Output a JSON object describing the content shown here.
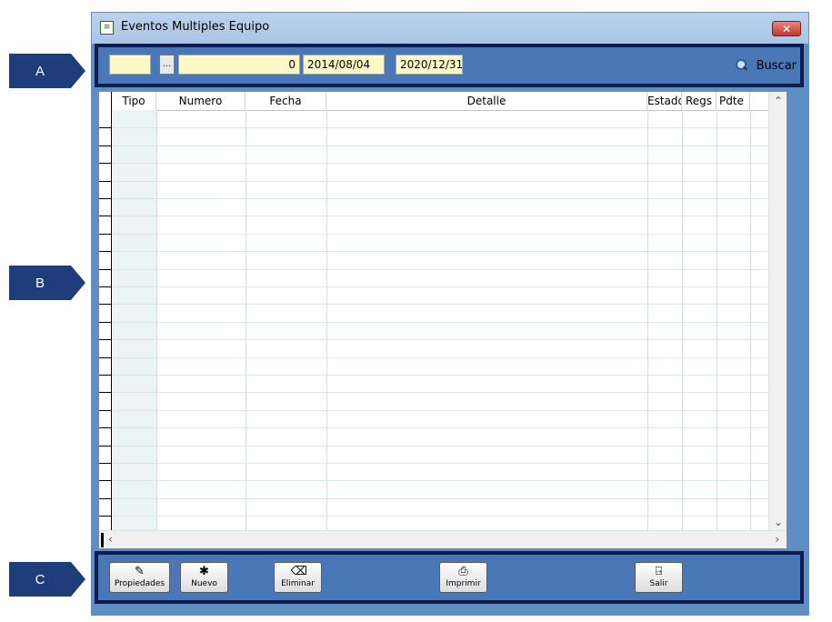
{
  "callouts": {
    "a": "A",
    "b": "B",
    "c": "C"
  },
  "window": {
    "title": "Eventos Multiples Equipo",
    "close_label": "✕"
  },
  "toolbar": {
    "field1_value": "",
    "dots_label": "...",
    "number_value": "0",
    "date_from": "2014/08/04",
    "date_to": "2020/12/31",
    "search_label": "Buscar"
  },
  "grid": {
    "columns": [
      "Tipo",
      "Numero",
      "Fecha",
      "Detalle",
      "Estado",
      "Regs",
      "Pdte"
    ],
    "rows": []
  },
  "buttons": {
    "properties": "Propiedades",
    "new": "Nuevo",
    "delete": "Eliminar",
    "print": "Imprimir",
    "exit": "Salir"
  },
  "colors": {
    "accent": "#4a78b6",
    "frame": "#0e1d4d",
    "callout": "#1f3d7a",
    "field_bg": "#fff8c6"
  }
}
